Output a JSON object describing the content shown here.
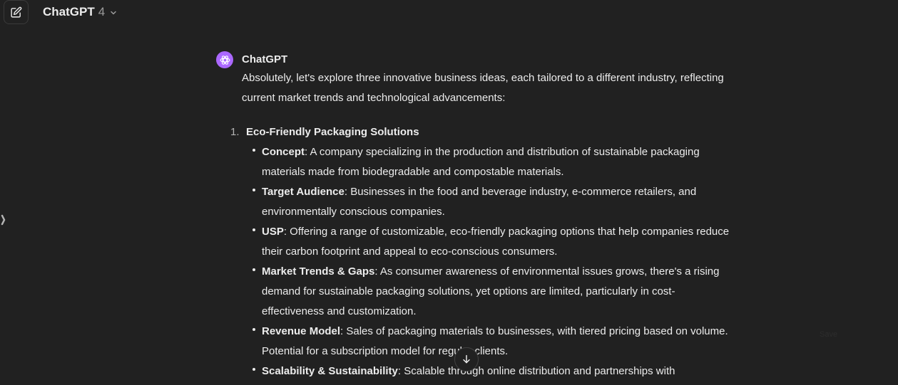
{
  "header": {
    "model_name": "ChatGPT",
    "model_version": "4"
  },
  "message": {
    "author": "ChatGPT",
    "intro": "Absolutely, let's explore three innovative business ideas, each tailored to a different industry, reflecting current market trends and technological advancements:",
    "ideas": [
      {
        "number": "1.",
        "title": "Eco-Friendly Packaging Solutions",
        "points": [
          {
            "term": "Concept",
            "text": ": A company specializing in the production and distribution of sustainable packaging materials made from biodegradable and compostable materials."
          },
          {
            "term": "Target Audience",
            "text": ": Businesses in the food and beverage industry, e-commerce retailers, and environmentally conscious companies."
          },
          {
            "term": "USP",
            "text": ": Offering a range of customizable, eco-friendly packaging options that help companies reduce their carbon footprint and appeal to eco-conscious consumers."
          },
          {
            "term": "Market Trends & Gaps",
            "text": ": As consumer awareness of environmental issues grows, there's a rising demand for sustainable packaging solutions, yet options are limited, particularly in cost-effectiveness and customization."
          },
          {
            "term": "Revenue Model",
            "text": ": Sales of packaging materials to businesses, with tiered pricing based on volume. Potential for a subscription model for regular clients."
          },
          {
            "term": "Scalability & Sustainability",
            "text": ": Scalable through online distribution and partnerships with"
          }
        ]
      }
    ]
  },
  "faint_label": "Save",
  "icons": {
    "new_chat": "edit-icon",
    "model_dropdown": "chevron-down-icon",
    "avatar": "openai-logo-icon",
    "sidebar_toggle": "chevron-right-icon",
    "scroll_down": "arrow-down-icon"
  },
  "colors": {
    "background": "#212121",
    "text": "#ececec",
    "muted": "#9b9b9b",
    "avatar": "#ab68ff"
  }
}
